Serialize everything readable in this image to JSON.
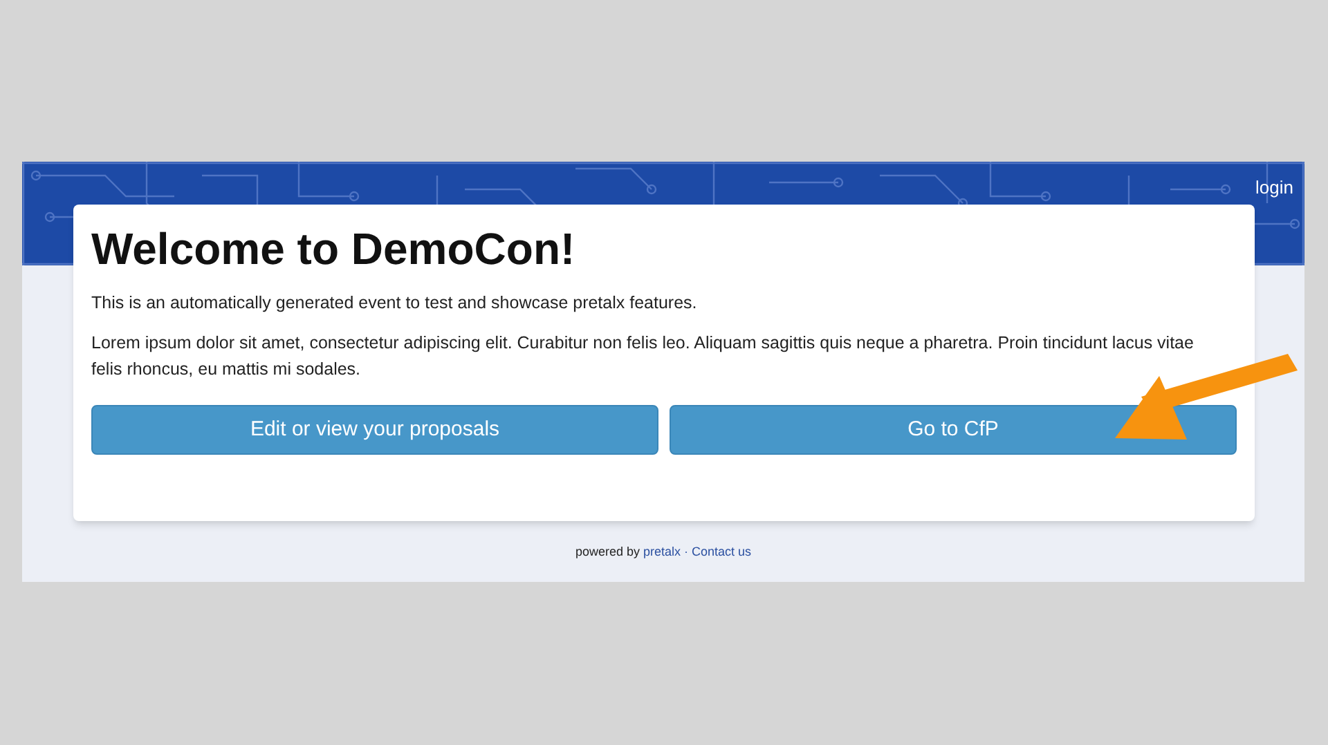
{
  "header": {
    "login": "login"
  },
  "card": {
    "title": "Welcome to DemoCon!",
    "intro": "This is an automatically generated event to test and showcase pretalx features.",
    "body": "Lorem ipsum dolor sit amet, consectetur adipiscing elit. Curabitur non felis leo. Aliquam sagittis quis neque a pharetra. Proin tincidunt lacus vitae felis rhoncus, eu mattis mi sodales.",
    "buttons": [
      "Edit or view your proposals",
      "Go to CfP"
    ]
  },
  "footer": {
    "prefix": "powered by",
    "brand": "pretalx",
    "separator": "·",
    "contact": "Contact us"
  }
}
